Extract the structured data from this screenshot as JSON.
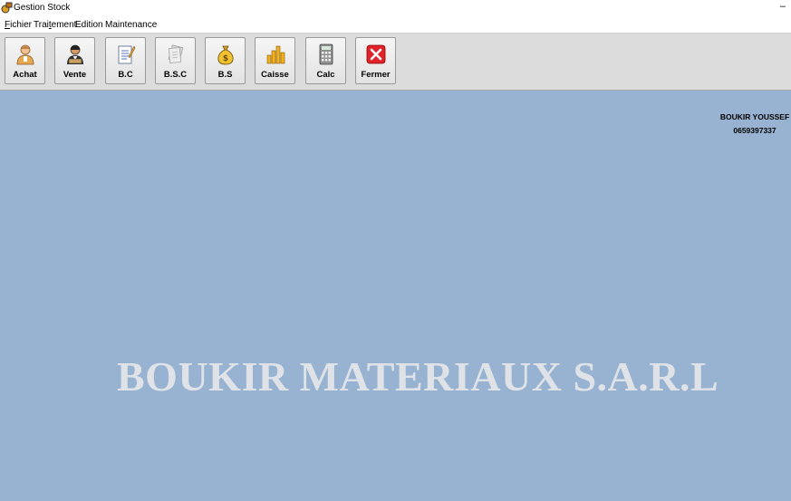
{
  "window": {
    "title": "Gestion Stock",
    "minimize_label": "–"
  },
  "menu": [
    {
      "before": "",
      "accel": "F",
      "after": "ichier"
    },
    {
      "before": "Trai",
      "accel": "t",
      "after": "ement"
    },
    {
      "before": "Edition",
      "accel": "",
      "after": ""
    },
    {
      "before": "Maintenance",
      "accel": "",
      "after": ""
    }
  ],
  "toolbar": {
    "buttons": [
      {
        "label": "Achat",
        "icon": "buyer-person-icon"
      },
      {
        "label": "Vente",
        "icon": "seller-person-icon"
      },
      {
        "label": "B.C",
        "icon": "order-document-icon"
      },
      {
        "label": "B.S.C",
        "icon": "paper-sheets-icon"
      },
      {
        "label": "B.S",
        "icon": "money-bag-icon"
      },
      {
        "label": "Caisse",
        "icon": "coin-stack-icon"
      },
      {
        "label": "Calc",
        "icon": "calculator-icon"
      },
      {
        "label": "Fermer",
        "icon": "close-x-icon"
      }
    ]
  },
  "user": {
    "name": "BOUKIR YOUSSEF",
    "phone": "0659397337"
  },
  "brand": {
    "text": "BOUKIR MATERIAUX S.A.R.L"
  },
  "colors": {
    "background": "#98b3d1",
    "toolbar": "#dcdcdc",
    "brand_text": "#dfe3e8",
    "close_red": "#e0232b"
  }
}
